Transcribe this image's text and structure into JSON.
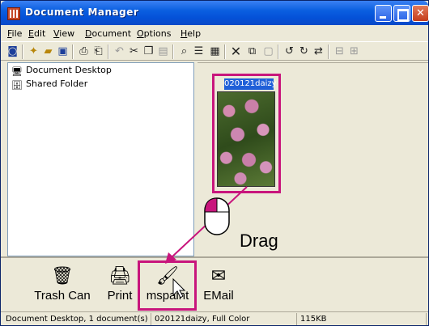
{
  "window": {
    "title": "Document Manager"
  },
  "menu": [
    "File",
    "Edit",
    "View",
    "Document",
    "Options",
    "Help"
  ],
  "toolbar_icons": [
    "view-icon",
    "new-folder-icon",
    "open-folder-icon",
    "save-icon",
    "scan-icon",
    "print-icon",
    "undo-icon",
    "cut-icon",
    "copy-icon",
    "paste-icon",
    "zoom-icon",
    "list-view-icon",
    "thumbnail-view-icon",
    "delete-icon",
    "duplicate-icon",
    "properties-icon",
    "rotate-left-icon",
    "rotate-right-icon",
    "flip-icon",
    "stack-icon",
    "unstack-icon"
  ],
  "tree": [
    {
      "label": "Document Desktop",
      "icon": "desktop-icon"
    },
    {
      "label": "Shared Folder",
      "icon": "shared-folder-icon"
    }
  ],
  "document": {
    "name": "020121daizy"
  },
  "annotation": {
    "drag_label": "Drag"
  },
  "dock": [
    {
      "label": "Trash Can",
      "icon": "trash-icon"
    },
    {
      "label": "Print",
      "icon": "printer-icon"
    },
    {
      "label": "mspaint",
      "icon": "paint-icon"
    },
    {
      "label": "EMail",
      "icon": "email-icon"
    }
  ],
  "status": {
    "location": "Document Desktop, 1 document(s)",
    "selection": "020121daizy, Full Color",
    "size": "115KB"
  },
  "colors": {
    "highlight": "#c8157c",
    "selection": "#1f5fd8",
    "titlebar": "#0a5fe0"
  }
}
